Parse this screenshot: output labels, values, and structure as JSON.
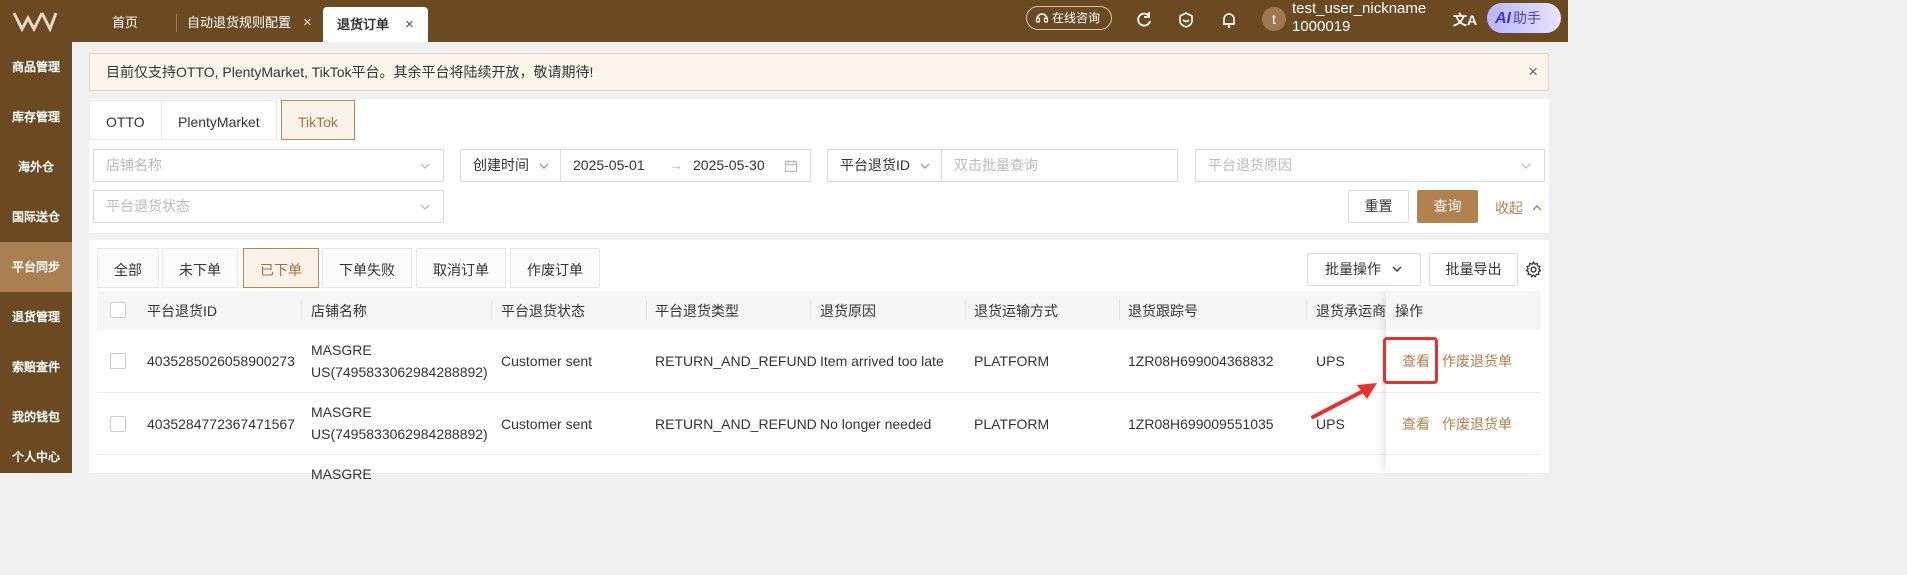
{
  "topbar": {
    "tabs": [
      {
        "label": "首页"
      },
      {
        "label": "自动退货规则配置",
        "close": "×"
      },
      {
        "label": "退货订单",
        "close": "×"
      }
    ],
    "consult_label": "在线咨询",
    "user_nickname": "test_user_nickname",
    "user_id": "1000019",
    "avatar_initial": "t",
    "translate_glyph": "文A",
    "ai_label": "AI",
    "ai_text": "助手"
  },
  "sidebar": {
    "items": [
      "商品管理",
      "库存管理",
      "海外仓",
      "国际送仓",
      "平台同步",
      "退货管理",
      "索赔查件",
      "我的钱包",
      "个人中心"
    ],
    "active": "平台同步"
  },
  "notice": {
    "text": "目前仅支持OTTO, PlentyMarket, TikTok平台。其余平台将陆续开放，敬请期待!",
    "close": "×"
  },
  "platform_tabs": [
    "OTTO",
    "PlentyMarket",
    "TikTok"
  ],
  "filters": {
    "store_placeholder": "店铺名称",
    "date_type": "创建时间",
    "date_start": "2025-05-01",
    "date_arrow": "→",
    "date_end": "2025-05-30",
    "id_type": "平台退货ID",
    "id_placeholder": "双击批量查询",
    "reason_placeholder": "平台退货原因",
    "status_placeholder": "平台退货状态",
    "reset_label": "重置",
    "search_label": "查询",
    "collapse_label": "收起"
  },
  "status_tabs": [
    "全部",
    "未下单",
    "已下单",
    "下单失败",
    "取消订单",
    "作废订单"
  ],
  "toolbar": {
    "batch_label": "批量操作",
    "export_label": "批量导出"
  },
  "table": {
    "headers": [
      "平台退货ID",
      "店铺名称",
      "平台退货状态",
      "平台退货类型",
      "退货原因",
      "退货运输方式",
      "退货跟踪号",
      "退货承运商",
      "操作"
    ],
    "rows": [
      {
        "id": "4035285026058900273",
        "store_1": "MASGRE",
        "store_2": "US(7495833062984288892)",
        "status": "Customer sent",
        "type": "RETURN_AND_REFUND",
        "reason": "Item arrived too late",
        "shipping": "PLATFORM",
        "tracking": "1ZR08H699004368832",
        "carrier": "UPS",
        "view": "查看",
        "void": "作废退货单"
      },
      {
        "id": "4035284772367471567",
        "store_1": "MASGRE",
        "store_2": "US(7495833062984288892)",
        "status": "Customer sent",
        "type": "RETURN_AND_REFUND",
        "reason": "No longer needed",
        "shipping": "PLATFORM",
        "tracking": "1ZR08H699009551035",
        "carrier": "UPS",
        "view": "查看",
        "void": "作废退货单"
      },
      {
        "store_1": "MASGRE"
      }
    ]
  },
  "colors": {
    "brand": "#6b4a22",
    "accent": "#b08250",
    "highlight": "#e5322d"
  }
}
